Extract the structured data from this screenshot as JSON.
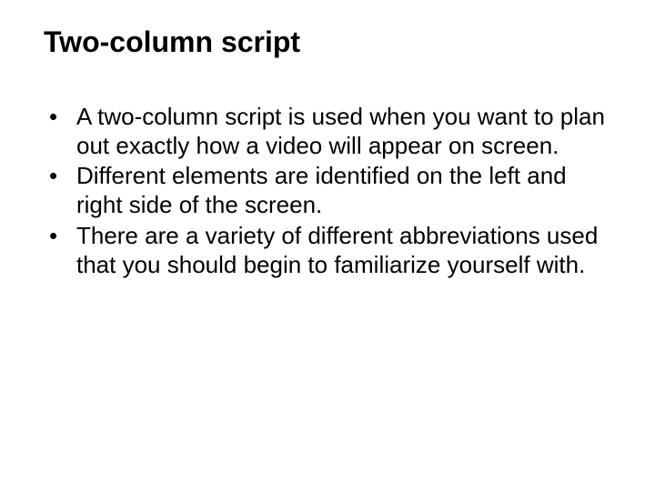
{
  "title": "Two-column script",
  "bullets": [
    "A two-column script is used when you want to plan out exactly how a video will appear on screen.",
    "Different elements are identified on the left and right side of the screen.",
    "There are a variety of different abbreviations used that you should begin to familiarize yourself with."
  ]
}
